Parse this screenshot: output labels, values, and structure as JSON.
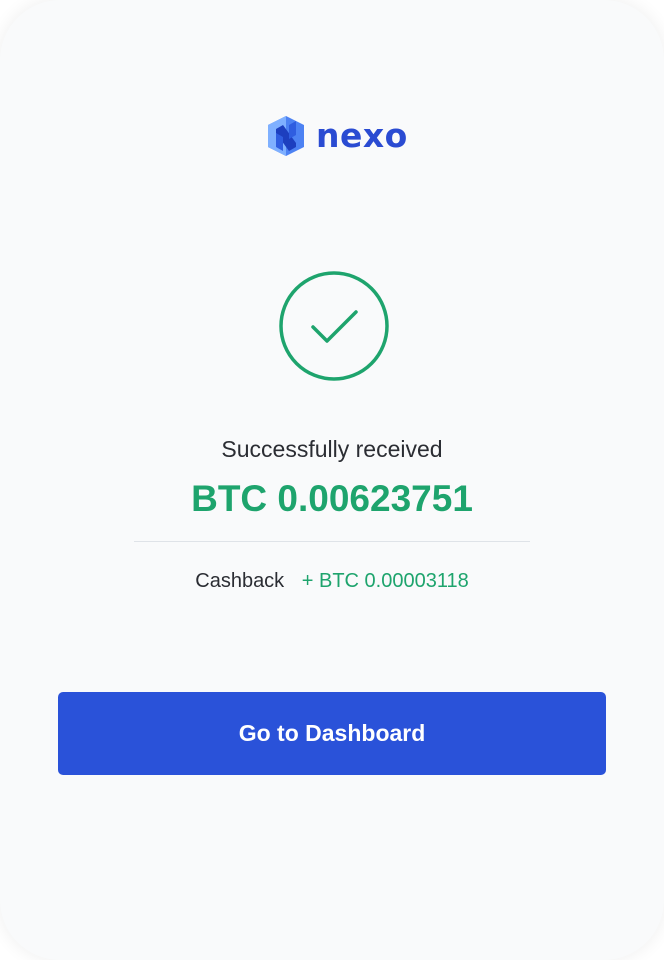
{
  "brand": {
    "name": "nexo",
    "icon": "nexo-logo-icon",
    "color": "#2a4bd2"
  },
  "status": {
    "icon": "check-circle-icon",
    "color": "#1ea46d",
    "label": "Successfully received",
    "amount": "BTC 0.00623751"
  },
  "cashback": {
    "label": "Cashback",
    "value": "+ BTC 0.00003118"
  },
  "actions": {
    "primary_label": "Go to Dashboard",
    "primary_color": "#2a52d9"
  }
}
